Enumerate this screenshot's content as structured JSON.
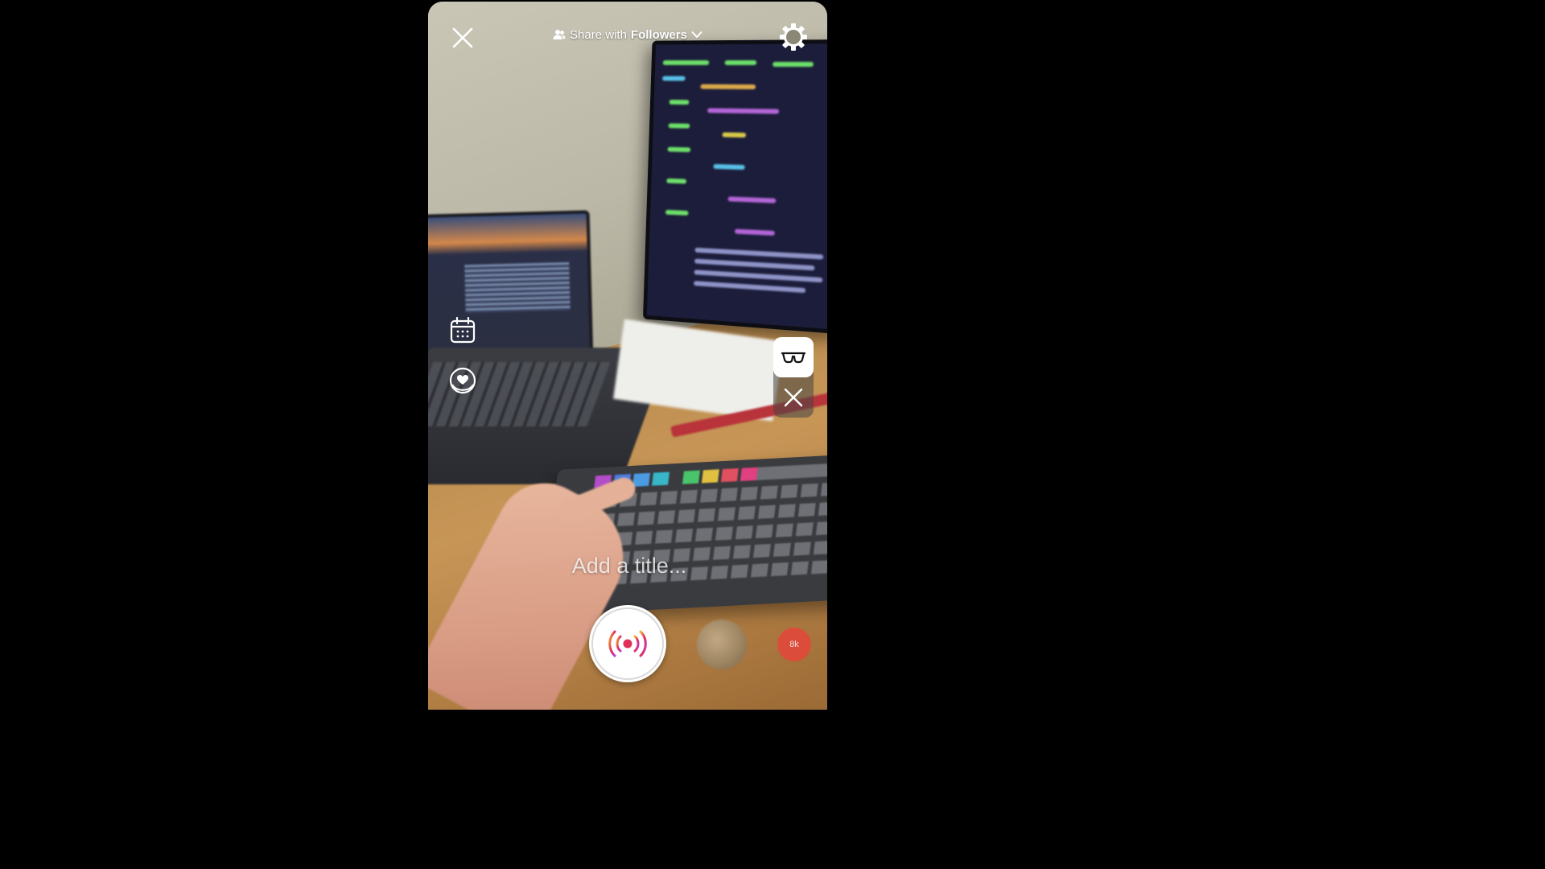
{
  "header": {
    "share_prefix": "Share with",
    "share_audience": "Followers"
  },
  "title_field": {
    "placeholder": "Add a title..."
  },
  "bottom": {
    "badge_text": "8k"
  },
  "icons": {
    "close": "close-icon",
    "audience": "people-icon",
    "dropdown": "chevron-down-icon",
    "settings": "gear-icon",
    "schedule": "calendar-icon",
    "fundraiser": "heart-badge-icon",
    "effect": "glasses-icon",
    "remove_effect": "close-icon",
    "go_live": "broadcast-icon"
  },
  "colors": {
    "badge": "#e04a3a",
    "live_ring_start": "#f5b53a",
    "live_ring_end": "#c43ad0",
    "live_dot": "#e0305a"
  }
}
